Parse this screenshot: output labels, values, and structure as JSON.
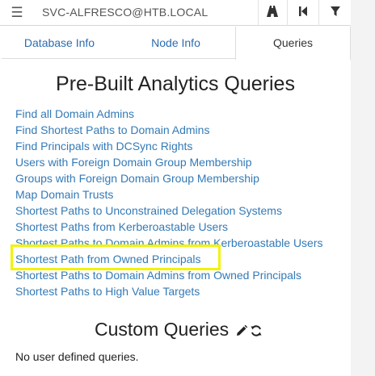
{
  "header": {
    "menu_glyph": "☰",
    "database_label": "SVC-ALFRESCO@HTB.LOCAL",
    "icons": [
      "pathfinding-icon",
      "back-icon",
      "filter-icon"
    ]
  },
  "tabs": [
    {
      "label": "Database Info",
      "active": false
    },
    {
      "label": "Node Info",
      "active": false
    },
    {
      "label": "Queries",
      "active": true
    }
  ],
  "prebuilt": {
    "title": "Pre-Built Analytics Queries",
    "queries": [
      "Find all Domain Admins",
      "Find Shortest Paths to Domain Admins",
      "Find Principals with DCSync Rights",
      "Users with Foreign Domain Group Membership",
      "Groups with Foreign Domain Group Membership",
      "Map Domain Trusts",
      "Shortest Paths to Unconstrained Delegation Systems",
      "Shortest Paths from Kerberoastable Users",
      "Shortest Paths to Domain Admins from Kerberoastable Users",
      "Shortest Path from Owned Principals",
      "Shortest Paths to Domain Admins from Owned Principals",
      "Shortest Paths to High Value Targets"
    ],
    "highlighted_index": 9
  },
  "custom": {
    "title": "Custom Queries",
    "empty_text": "No user defined queries.",
    "icons": [
      "pencil-icon",
      "refresh-icon"
    ]
  },
  "colors": {
    "link": "#337ab7",
    "highlight": "#f2f20a"
  }
}
